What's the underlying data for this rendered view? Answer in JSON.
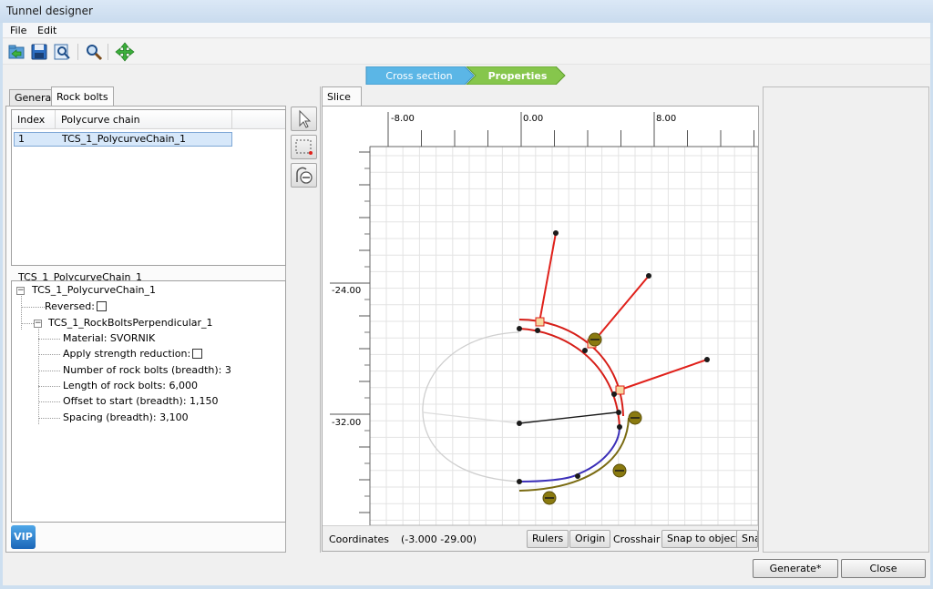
{
  "window": {
    "title": "Tunnel designer"
  },
  "menu": [
    "File",
    "Edit"
  ],
  "toolbar": {
    "icons": [
      "import-icon",
      "save-icon",
      "print-preview-icon",
      "zoom-icon",
      "move-icon"
    ]
  },
  "wizard": {
    "steps": [
      "Cross section",
      "Properties"
    ],
    "active": 1
  },
  "left_tabs": {
    "general": "General",
    "rock_bolts": "Rock bolts"
  },
  "table": {
    "columns": [
      "Index",
      "Polycurve chain"
    ],
    "rows": [
      {
        "index": "1",
        "chain": "TCS_1_PolycurveChain_1"
      }
    ]
  },
  "properties": {
    "label": "TCS_1_PolycurveChain_1",
    "root": "TCS_1_PolycurveChain_1",
    "reversed": "Reversed:",
    "child": "TCS_1_RockBoltsPerpendicular_1",
    "material": "Material: SVORNIK",
    "strength": "Apply strength reduction:",
    "count": "Number of rock bolts (breadth): 3",
    "length": "Length of rock bolts: 6,000",
    "offset": "Offset to start (breadth): 1,150",
    "spacing": "Spacing (breadth): 3,100"
  },
  "vip_label": "VIP",
  "slice": {
    "tab": "Slice",
    "ruler_x": [
      "-8.00",
      "0.00",
      "8.00"
    ],
    "ruler_y": [
      "-24.00",
      "-32.00"
    ]
  },
  "bottombar": {
    "coords_label": "Coordinates",
    "coords_value": "(-3.000 -29.00)",
    "rulers": "Rulers",
    "origin": "Origin",
    "crosshair": "Crosshair",
    "snap_object": "Snap to object",
    "snap_more": "Sna"
  },
  "footer": {
    "generate": "Generate*",
    "close": "Close"
  },
  "colors": {
    "bolt": "#e0201a",
    "lining": "#d61e18",
    "blue": "#3b2fb8",
    "olive": "#7a6b12",
    "black_line": "#1a1a1a",
    "gray": "#cfcfcf"
  }
}
